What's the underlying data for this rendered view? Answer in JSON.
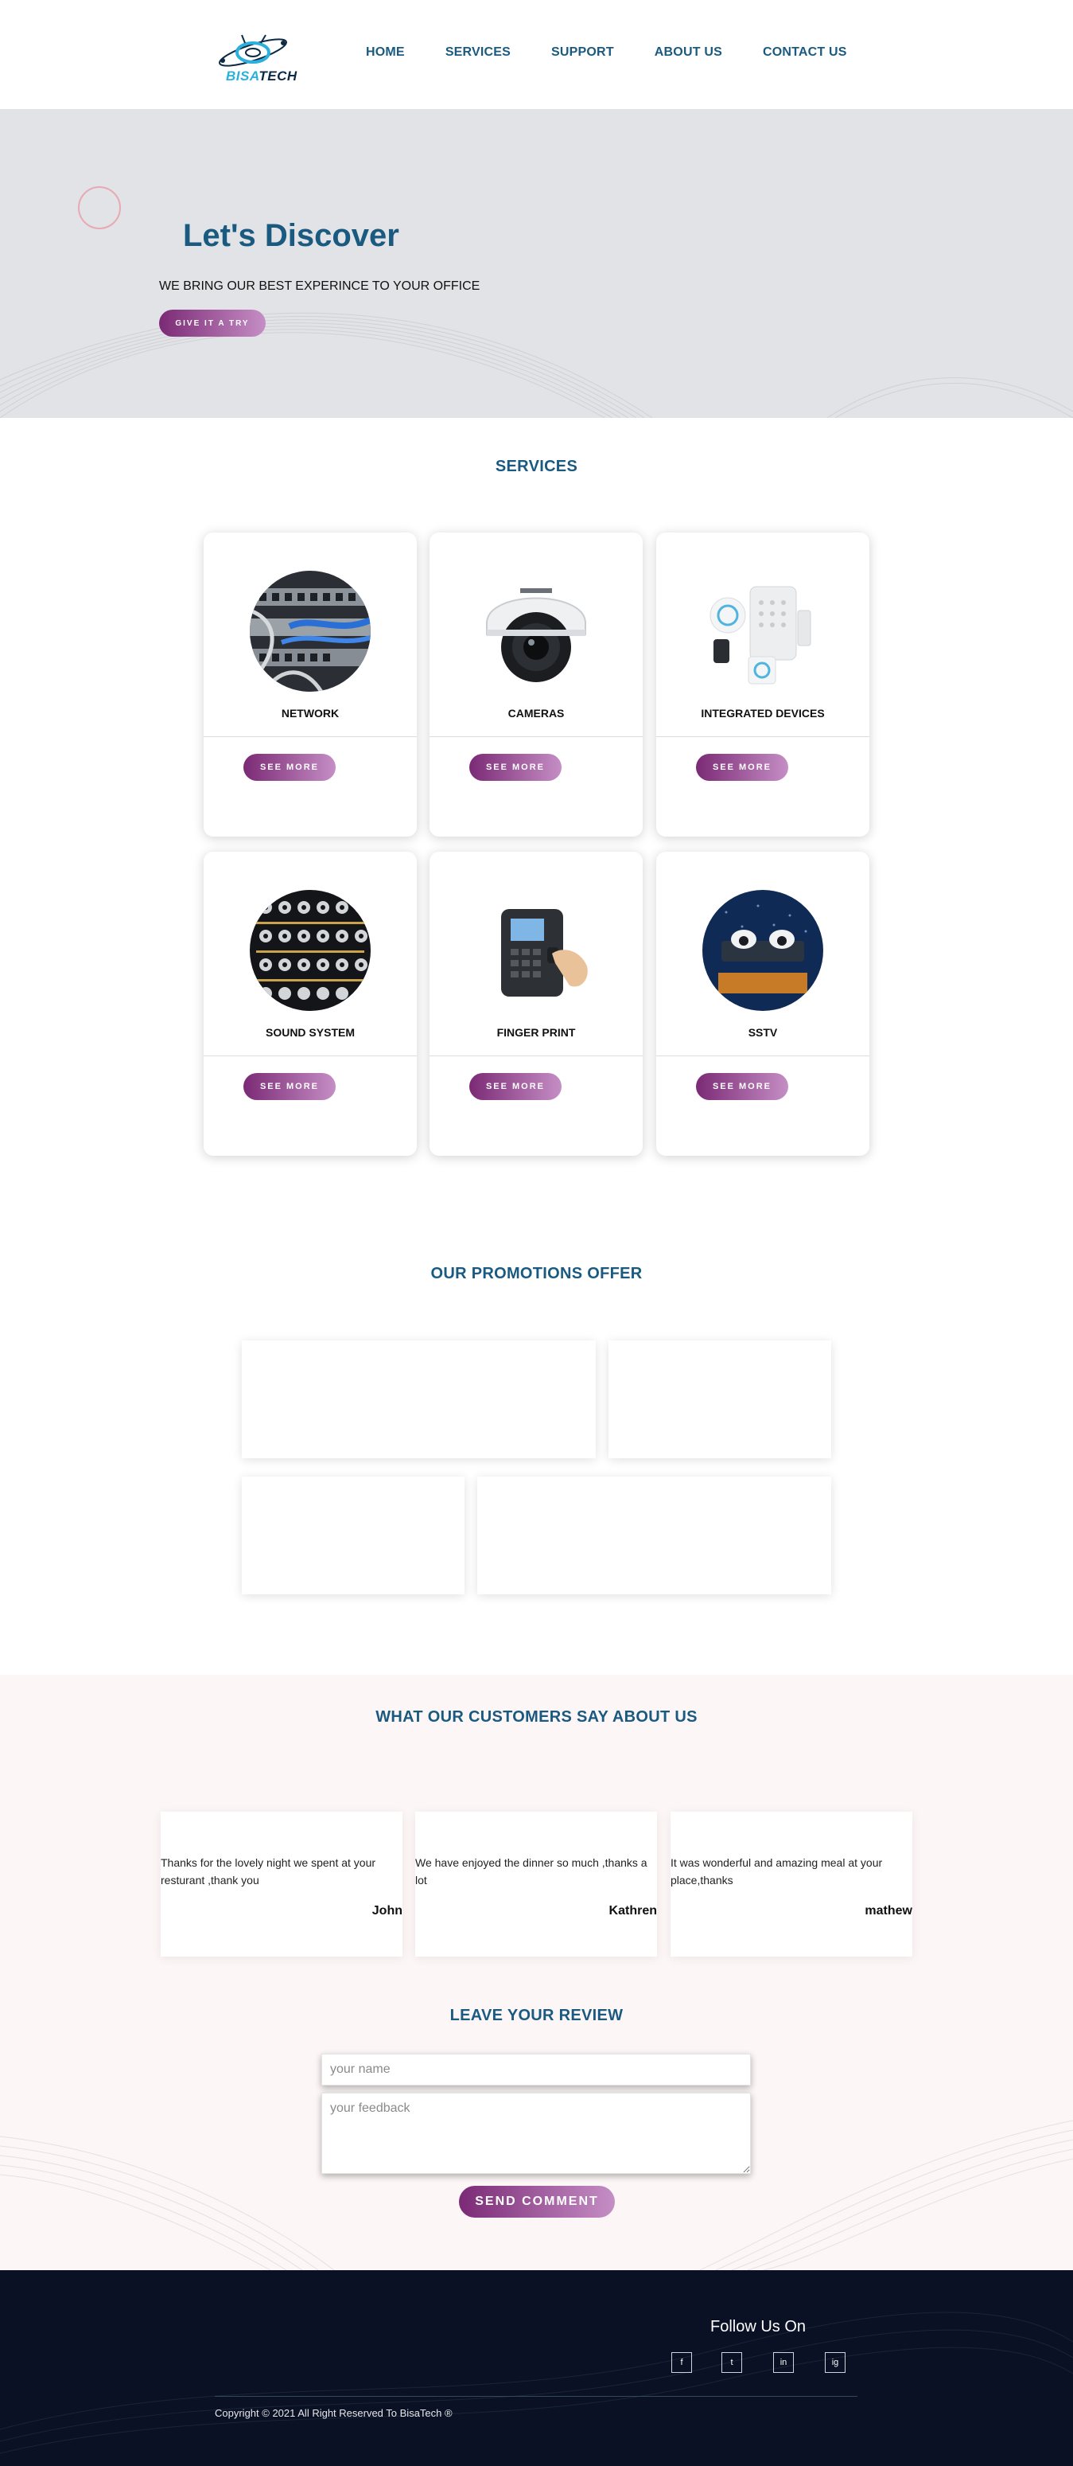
{
  "brand": {
    "logo_part1": "BISA",
    "logo_part2": "TECH"
  },
  "nav": {
    "items": [
      {
        "label": "HOME"
      },
      {
        "label": "SERVICES"
      },
      {
        "label": "SUPPORT"
      },
      {
        "label": "ABOUT US"
      },
      {
        "label": "CONTACT US"
      }
    ]
  },
  "hero": {
    "title": "Let's Discover",
    "subtitle": "WE BRING OUR BEST EXPERINCE TO YOUR OFFICE",
    "cta_label": "GIVE IT A TRY"
  },
  "services": {
    "title": "SERVICES",
    "more_label": "SEE MORE",
    "items": [
      {
        "name": "NETWORK",
        "icon": "network-icon"
      },
      {
        "name": "CAMERAS",
        "icon": "camera-icon"
      },
      {
        "name": "INTEGRATED DEVICES",
        "icon": "integrated-devices-icon"
      },
      {
        "name": "SOUND SYSTEM",
        "icon": "sound-system-icon"
      },
      {
        "name": "FINGER PRINT",
        "icon": "fingerprint-icon"
      },
      {
        "name": "SSTV",
        "icon": "sstv-icon"
      }
    ]
  },
  "promotions": {
    "title": "OUR PROMOTIONS OFFER"
  },
  "testimonials": {
    "title": "WHAT OUR CUSTOMERS SAY ABOUT US",
    "items": [
      {
        "quote": "Thanks for the lovely night we spent at your resturant ,thank you",
        "author": "John"
      },
      {
        "quote": "We have enjoyed the dinner so much ,thanks a lot",
        "author": "Kathren"
      },
      {
        "quote": "It was wonderful and amazing meal at your place,thanks",
        "author": "mathew"
      }
    ]
  },
  "review": {
    "title": "LEAVE YOUR REVIEW",
    "name_placeholder": "your name",
    "name_value": "",
    "feedback_placeholder": "your feedback",
    "feedback_value": "",
    "send_label": "SEND COMMENT"
  },
  "footer": {
    "follow_title": "Follow Us On",
    "social": [
      {
        "glyph": "f",
        "icon": "facebook-icon"
      },
      {
        "glyph": "t",
        "icon": "twitter-icon"
      },
      {
        "glyph": "in",
        "icon": "linkedin-icon"
      },
      {
        "glyph": "ig",
        "icon": "instagram-icon"
      }
    ],
    "copyright": "Copyright © 2021 All Right Reserved To BisaTech ®"
  },
  "colors": {
    "primary": "#1a5a80",
    "accent_start": "#7b2a75",
    "accent_end": "#c58ec5",
    "hero_bg": "#e1e3e6",
    "testimonial_bg": "#fcf6f6",
    "footer_bg": "#0a1124"
  }
}
